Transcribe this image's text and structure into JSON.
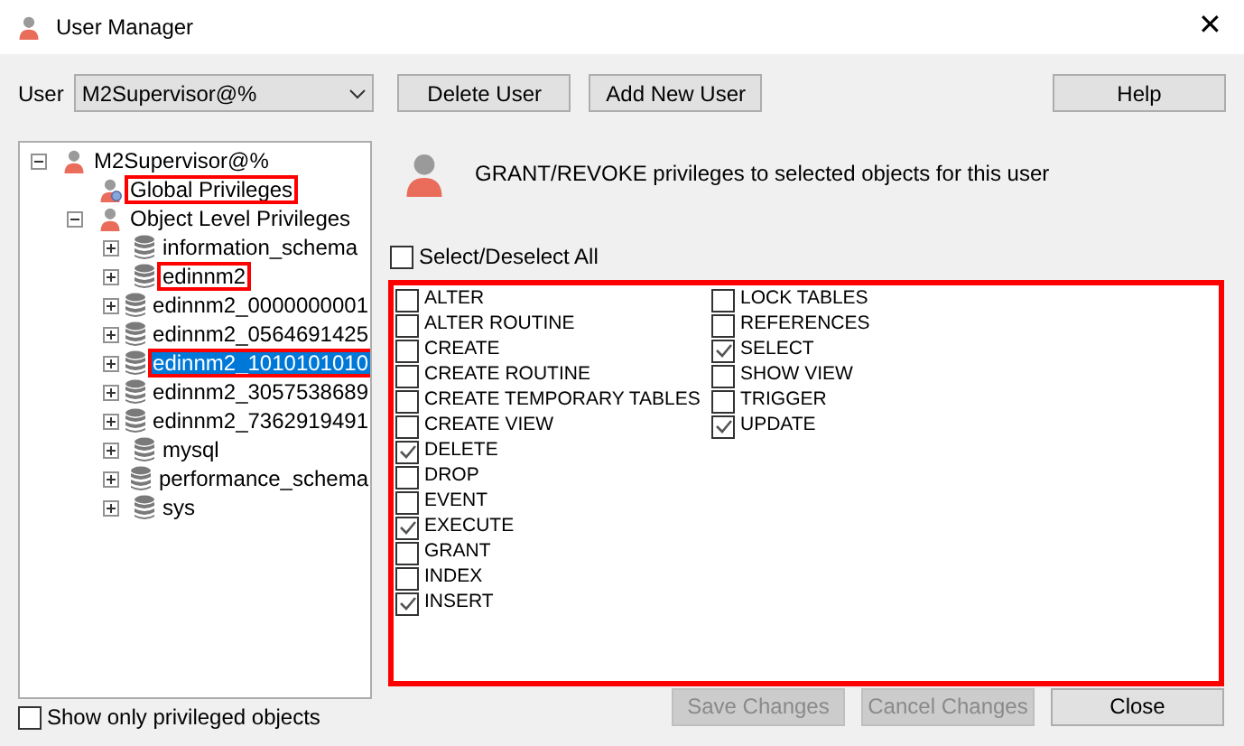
{
  "window": {
    "title": "User Manager",
    "close": "✕"
  },
  "user_select": {
    "label": "User",
    "value": "M2Supervisor@%"
  },
  "top_buttons": [
    {
      "label": "Delete User",
      "disabled": false
    },
    {
      "label": "Add New User",
      "disabled": false
    },
    {
      "label": "Help",
      "disabled": false
    }
  ],
  "tree": [
    {
      "label": "M2Supervisor@%",
      "kind": "user",
      "expanded": true,
      "selected": false,
      "highlighted": false,
      "children": [
        {
          "label": "Global Privileges",
          "kind": "global",
          "selected": false,
          "highlighted": true
        },
        {
          "label": "Object Level Privileges",
          "kind": "user",
          "expanded": true,
          "selected": false,
          "highlighted": false,
          "children": [
            {
              "label": "information_schema",
              "kind": "database",
              "expanded": false,
              "selected": false,
              "highlighted": false
            },
            {
              "label": "edinnm2",
              "kind": "database",
              "expanded": false,
              "selected": false,
              "highlighted": true
            },
            {
              "label": "edinnm2_0000000001",
              "kind": "database",
              "expanded": false,
              "selected": false,
              "highlighted": false
            },
            {
              "label": "edinnm2_0564691425",
              "kind": "database",
              "expanded": false,
              "selected": false,
              "highlighted": false
            },
            {
              "label": "edinnm2_1010101010",
              "kind": "database",
              "expanded": false,
              "selected": true,
              "highlighted": true
            },
            {
              "label": "edinnm2_3057538689",
              "kind": "database",
              "expanded": false,
              "selected": false,
              "highlighted": false
            },
            {
              "label": "edinnm2_7362919491",
              "kind": "database",
              "expanded": false,
              "selected": false,
              "highlighted": false
            },
            {
              "label": "mysql",
              "kind": "database",
              "expanded": false,
              "selected": false,
              "highlighted": false
            },
            {
              "label": "performance_schema",
              "kind": "database",
              "expanded": false,
              "selected": false,
              "highlighted": false
            },
            {
              "label": "sys",
              "kind": "database",
              "expanded": false,
              "selected": false,
              "highlighted": false
            }
          ]
        }
      ]
    }
  ],
  "header_text": "GRANT/REVOKE privileges to selected objects for this user",
  "select_all": {
    "label": "Select/Deselect All",
    "checked": false
  },
  "privileges": {
    "highlighted": true,
    "columns": [
      [
        {
          "label": "ALTER",
          "checked": false
        },
        {
          "label": "ALTER ROUTINE",
          "checked": false
        },
        {
          "label": "CREATE",
          "checked": false
        },
        {
          "label": "CREATE ROUTINE",
          "checked": false
        },
        {
          "label": "CREATE TEMPORARY TABLES",
          "checked": false
        },
        {
          "label": "CREATE VIEW",
          "checked": false
        },
        {
          "label": "DELETE",
          "checked": true
        },
        {
          "label": "DROP",
          "checked": false
        },
        {
          "label": "EVENT",
          "checked": false
        },
        {
          "label": "EXECUTE",
          "checked": true
        },
        {
          "label": "GRANT",
          "checked": false
        },
        {
          "label": "INDEX",
          "checked": false
        },
        {
          "label": "INSERT",
          "checked": true
        }
      ],
      [
        {
          "label": "LOCK TABLES",
          "checked": false
        },
        {
          "label": "REFERENCES",
          "checked": false
        },
        {
          "label": "SELECT",
          "checked": true
        },
        {
          "label": "SHOW VIEW",
          "checked": false
        },
        {
          "label": "TRIGGER",
          "checked": false
        },
        {
          "label": "UPDATE",
          "checked": true
        }
      ]
    ]
  },
  "show_only_privileged": {
    "label": "Show only privileged objects",
    "checked": false
  },
  "bottom_buttons": [
    {
      "label": "Save Changes",
      "disabled": true
    },
    {
      "label": "Cancel Changes",
      "disabled": true
    },
    {
      "label": "Close",
      "disabled": false
    }
  ]
}
